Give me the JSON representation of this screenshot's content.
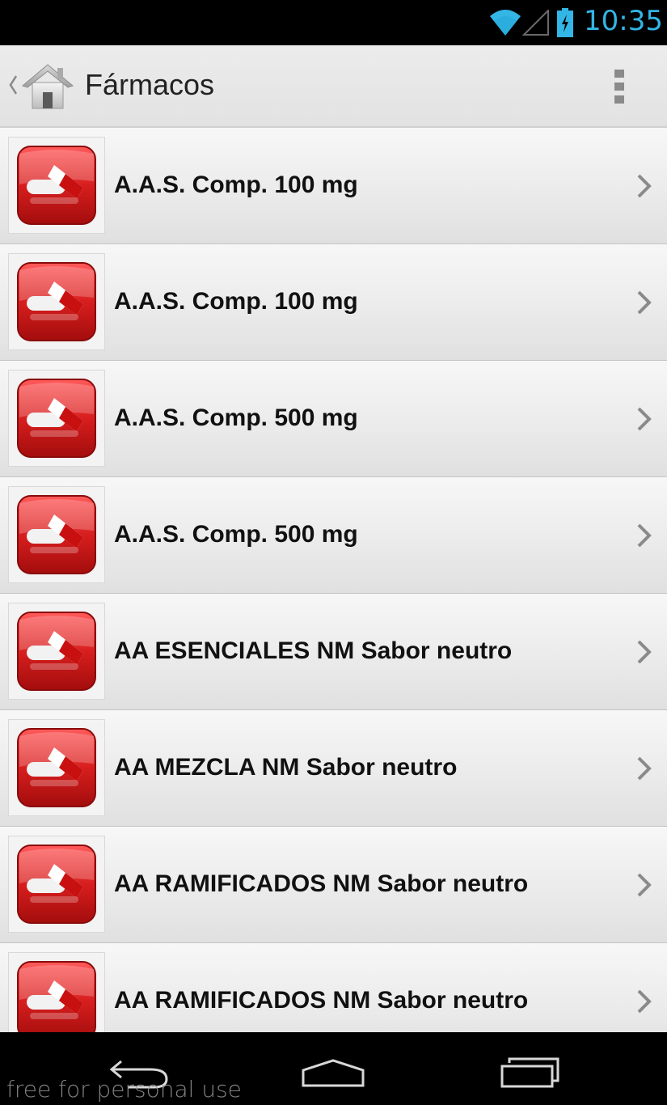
{
  "status_bar": {
    "time": "10:35",
    "icons": [
      "wifi-icon",
      "signal-icon",
      "battery-charging-icon"
    ],
    "accent_color": "#33b5e5"
  },
  "action_bar": {
    "title": "Fármacos",
    "icons": [
      "up-caret-icon",
      "home-icon",
      "overflow-menu-icon"
    ]
  },
  "list": {
    "item_icon": "pill-capsule-icon",
    "item_icon_color": "#d81e1e",
    "items": [
      {
        "label": "A.A.S. Comp. 100 mg"
      },
      {
        "label": "A.A.S. Comp. 100 mg"
      },
      {
        "label": "A.A.S. Comp. 500 mg"
      },
      {
        "label": "A.A.S. Comp. 500 mg"
      },
      {
        "label": "AA ESENCIALES NM Sabor neutro"
      },
      {
        "label": "AA MEZCLA NM Sabor neutro"
      },
      {
        "label": "AA RAMIFICADOS NM Sabor neutro"
      },
      {
        "label": "AA RAMIFICADOS NM Sabor neutro"
      }
    ]
  },
  "nav_bar": {
    "icons": [
      "back-icon",
      "home-nav-icon",
      "recent-apps-icon"
    ]
  },
  "watermark": "free for personal use"
}
